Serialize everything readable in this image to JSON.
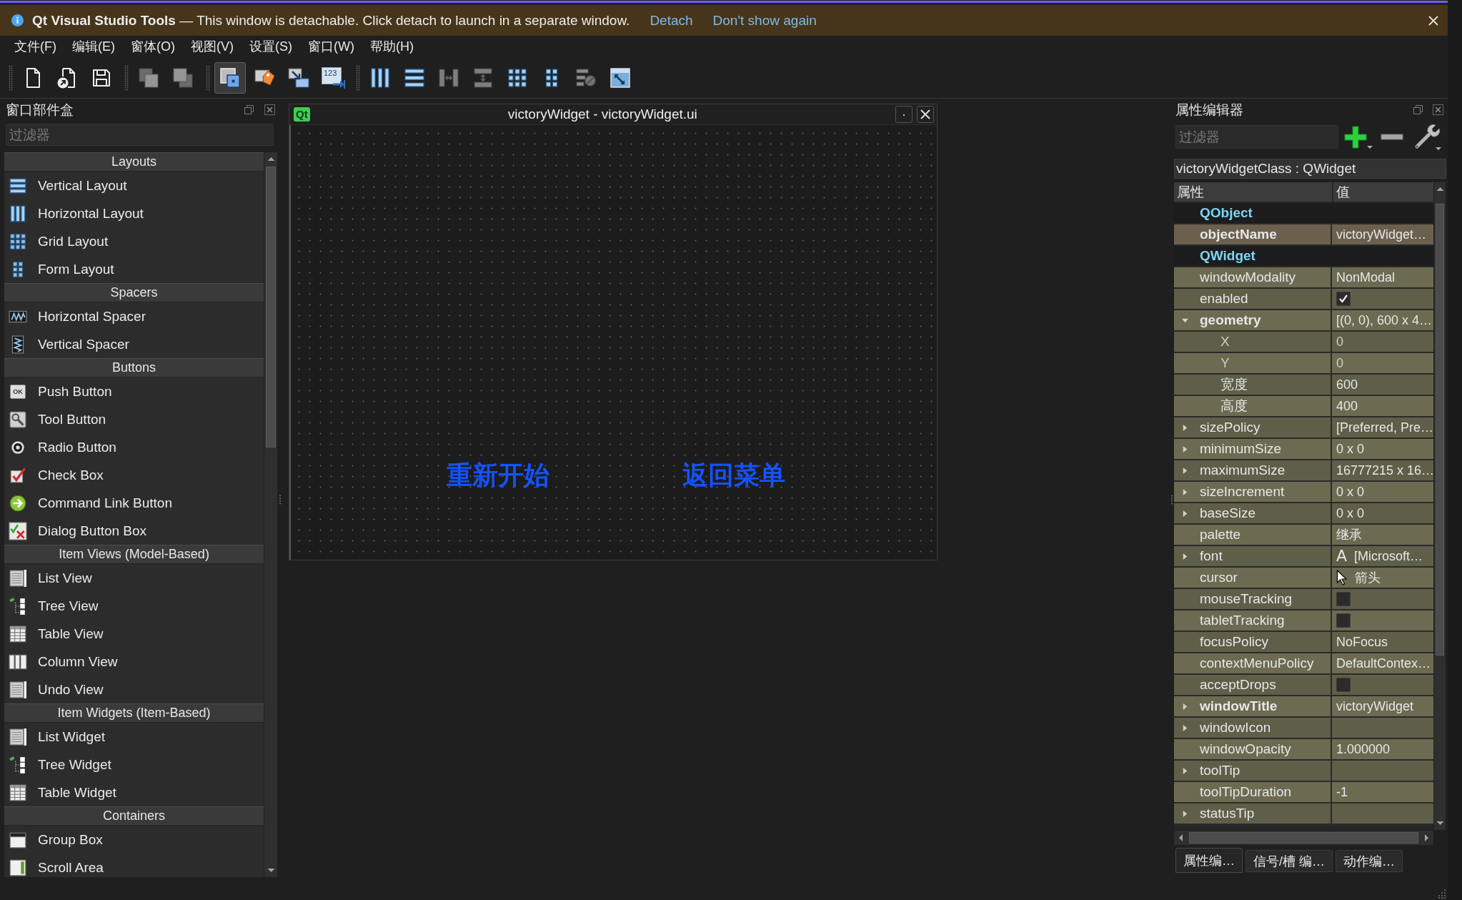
{
  "info_bar": {
    "message": "**Qt Visual Studio Tools** — This window is detachable. Click detach to launch in a separate window.",
    "links": [
      "Detach",
      "Don't show again"
    ]
  },
  "menu": [
    "文件(F)",
    "编辑(E)",
    "窗体(O)",
    "视图(V)",
    "设置(S)",
    "窗口(W)",
    "帮助(H)"
  ],
  "toolbar_groups": [
    {
      "buttons": [
        {
          "kind": "new",
          "disabled": false,
          "selected": false
        },
        {
          "kind": "open",
          "disabled": false,
          "selected": false
        },
        {
          "kind": "save",
          "disabled": false,
          "selected": false
        }
      ]
    },
    {
      "buttons": [
        {
          "kind": "back",
          "disabled": true,
          "selected": false
        },
        {
          "kind": "front",
          "disabled": true,
          "selected": false
        }
      ]
    },
    {
      "buttons": [
        {
          "kind": "edit",
          "disabled": false,
          "selected": true
        },
        {
          "kind": "signals",
          "disabled": false,
          "selected": false
        },
        {
          "kind": "buddies",
          "disabled": false,
          "selected": false
        },
        {
          "kind": "taborder",
          "icon_text": "123",
          "disabled": false,
          "selected": false
        }
      ]
    },
    {
      "buttons": [
        {
          "kind": "hbox",
          "disabled": false,
          "selected": false
        },
        {
          "kind": "vbox",
          "disabled": false,
          "selected": false
        },
        {
          "kind": "hsplit",
          "disabled": true,
          "selected": false
        },
        {
          "kind": "vsplit",
          "disabled": true,
          "selected": false
        },
        {
          "kind": "grid",
          "disabled": false,
          "selected": false
        },
        {
          "kind": "form",
          "disabled": false,
          "selected": false
        },
        {
          "kind": "break",
          "disabled": true,
          "selected": false
        },
        {
          "kind": "adjust",
          "disabled": false,
          "selected": false
        }
      ]
    }
  ],
  "widget_box": {
    "title": "窗口部件盒",
    "filter": {
      "placeholder": "过滤器"
    },
    "categories": [
      {
        "name": "Layouts",
        "items": [
          {
            "kind": "vbox",
            "label": "Vertical Layout"
          },
          {
            "kind": "hbox",
            "label": "Horizontal Layout"
          },
          {
            "kind": "grid",
            "label": "Grid Layout"
          },
          {
            "kind": "form",
            "label": "Form Layout"
          }
        ]
      },
      {
        "name": "Spacers",
        "items": [
          {
            "kind": "hspacer",
            "label": "Horizontal Spacer"
          },
          {
            "kind": "vspacer",
            "label": "Vertical Spacer"
          }
        ]
      },
      {
        "name": "Buttons",
        "items": [
          {
            "kind": "button",
            "icon_text": "OK",
            "label": "Push Button"
          },
          {
            "kind": "toolbutton",
            "label": "Tool Button"
          },
          {
            "kind": "radio",
            "label": "Radio Button"
          },
          {
            "kind": "check",
            "label": "Check Box"
          },
          {
            "kind": "commandlink",
            "label": "Command Link Button"
          },
          {
            "kind": "buttonbox",
            "label": "Dialog Button Box"
          }
        ]
      },
      {
        "name": "Item Views (Model-Based)",
        "items": [
          {
            "kind": "list",
            "label": "List View"
          },
          {
            "kind": "tree",
            "label": "Tree View"
          },
          {
            "kind": "table",
            "label": "Table View"
          },
          {
            "kind": "column",
            "label": "Column View"
          },
          {
            "kind": "undo",
            "label": "Undo View"
          }
        ]
      },
      {
        "name": "Item Widgets (Item-Based)",
        "items": [
          {
            "kind": "list",
            "label": "List Widget"
          },
          {
            "kind": "tree",
            "label": "Tree Widget"
          },
          {
            "kind": "table",
            "label": "Table Widget"
          }
        ]
      },
      {
        "name": "Containers",
        "items": [
          {
            "kind": "groupbox",
            "label": "Group Box"
          },
          {
            "kind": "scrollarea",
            "label": "Scroll Area"
          }
        ]
      }
    ]
  },
  "form_window": {
    "logo": "Qt",
    "title": "victoryWidget - victoryWidget.ui",
    "labels": [
      "重新开始",
      "返回菜单"
    ]
  },
  "property_editor": {
    "title": "属性编辑器",
    "filter": {
      "placeholder": "过滤器"
    },
    "object": "victoryWidgetClass : QWidget",
    "columns": [
      "属性",
      "值"
    ],
    "groups": [
      {
        "name": "QObject",
        "color": "#6b604e",
        "properties": [
          {
            "kind": "text",
            "name": "objectName",
            "value": "victoryWidget…",
            "modified": true
          }
        ]
      },
      {
        "name": "QWidget",
        "color": "#6c6b52",
        "properties": [
          {
            "kind": "text",
            "name": "windowModality",
            "value": "NonModal",
            "modified": false
          },
          {
            "kind": "check",
            "name": "enabled",
            "checked": true,
            "modified": false
          },
          {
            "kind": "text",
            "name": "geometry",
            "value": "[(0, 0), 600 x 4…",
            "modified": true,
            "expanded": true,
            "children": [
              {
                "kind": "text",
                "name": "X",
                "value": "0",
                "modified": false,
                "disabled": true
              },
              {
                "kind": "text",
                "name": "Y",
                "value": "0",
                "modified": false,
                "disabled": true
              },
              {
                "kind": "text",
                "name": "宽度",
                "value": "600",
                "modified": false,
                "disabled": false
              },
              {
                "kind": "text",
                "name": "高度",
                "value": "400",
                "modified": false,
                "disabled": false
              }
            ]
          },
          {
            "kind": "text",
            "name": "sizePolicy",
            "value": "[Preferred, Pre…",
            "modified": false,
            "expanded": false
          },
          {
            "kind": "text",
            "name": "minimumSize",
            "value": "0 x 0",
            "modified": false,
            "expanded": false
          },
          {
            "kind": "text",
            "name": "maximumSize",
            "value": "16777215 x 16…",
            "modified": false,
            "expanded": false
          },
          {
            "kind": "text",
            "name": "sizeIncrement",
            "value": "0 x 0",
            "modified": false,
            "expanded": false
          },
          {
            "kind": "text",
            "name": "baseSize",
            "value": "0 x 0",
            "modified": false,
            "expanded": false
          },
          {
            "kind": "text",
            "name": "palette",
            "value": "继承",
            "modified": false
          },
          {
            "kind": "font",
            "name": "font",
            "sample": "A",
            "value": "[Microsoft…",
            "modified": false,
            "expanded": false
          },
          {
            "kind": "cursor",
            "name": "cursor",
            "value": "箭头",
            "modified": false
          },
          {
            "kind": "check",
            "name": "mouseTracking",
            "checked": false,
            "modified": false
          },
          {
            "kind": "check",
            "name": "tabletTracking",
            "checked": false,
            "modified": false
          },
          {
            "kind": "text",
            "name": "focusPolicy",
            "value": "NoFocus",
            "modified": false
          },
          {
            "kind": "text",
            "name": "contextMenuPolicy",
            "value": "DefaultContex…",
            "modified": false
          },
          {
            "kind": "check",
            "name": "acceptDrops",
            "checked": false,
            "modified": false
          },
          {
            "kind": "text",
            "name": "windowTitle",
            "value": "victoryWidget",
            "modified": true,
            "expanded": false
          },
          {
            "kind": "text",
            "name": "windowIcon",
            "modified": false,
            "expanded": false
          },
          {
            "kind": "text",
            "name": "windowOpacity",
            "value": "1.000000",
            "modified": false
          },
          {
            "kind": "text",
            "name": "toolTip",
            "modified": false,
            "expanded": false
          },
          {
            "kind": "text",
            "name": "toolTipDuration",
            "value": "-1",
            "modified": false
          },
          {
            "kind": "text",
            "name": "statusTip",
            "modified": false,
            "expanded": false
          }
        ]
      }
    ]
  },
  "bottom_tabs": [
    {
      "label": "属性编…",
      "selected": true
    },
    {
      "label": "信号/槽 编…",
      "selected": false
    },
    {
      "label": "动作编…",
      "selected": false
    }
  ]
}
